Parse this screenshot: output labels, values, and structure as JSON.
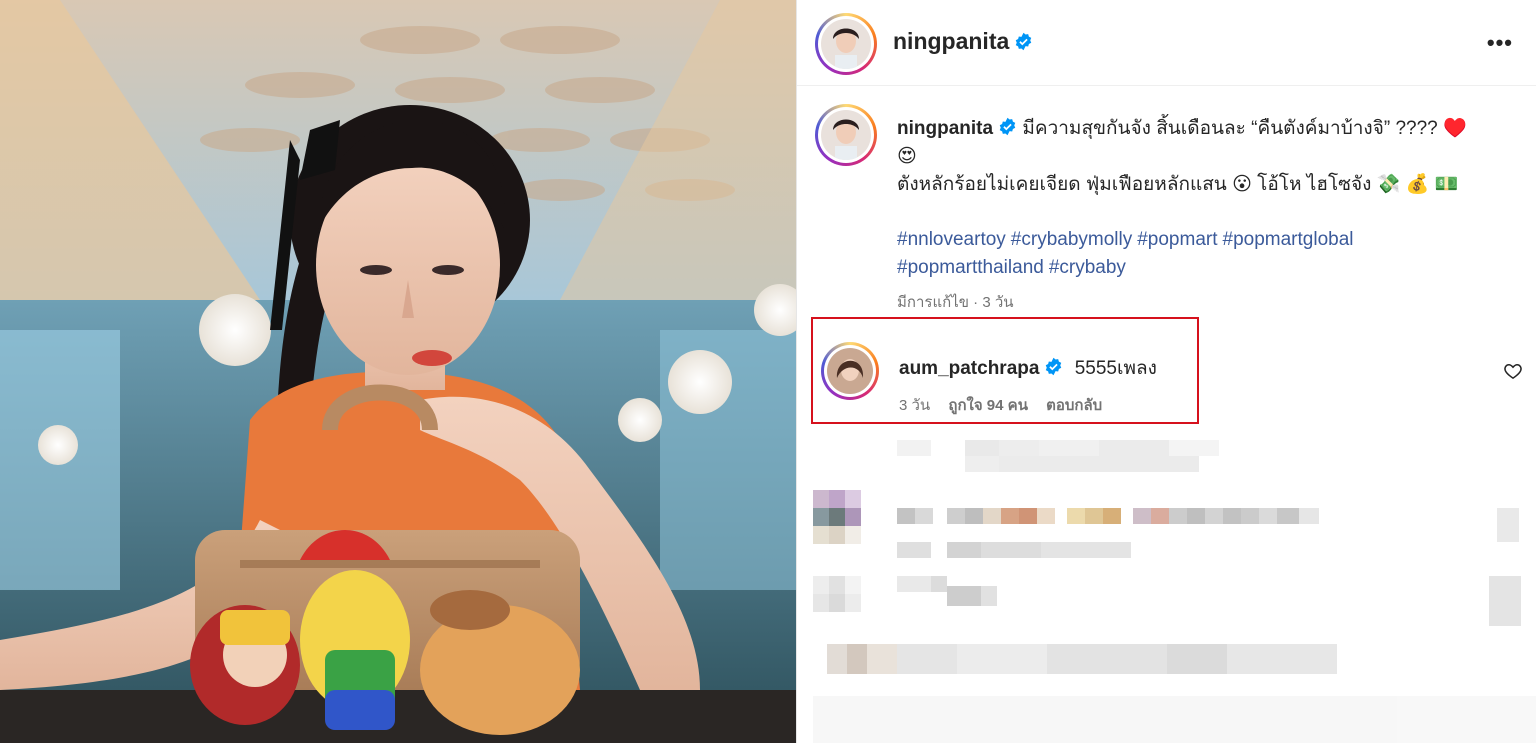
{
  "post": {
    "username": "ningpanita",
    "verified": true,
    "more_label": "•••",
    "caption": {
      "username": "ningpanita",
      "line1": "มีความสุขกันจัง สิ้นเดือนละ “คืนตังค์มาบ้างจิ” ???? ♥️",
      "line1_emoji": "😍",
      "line2": "ตังหลักร้อยไม่เคยเจียด ฟุ่มเฟือยหลักแสน 😮 โอ้โห ไฮโซจัง 💸 💰 💵",
      "hashtags": [
        "#nnloveartoy",
        "#crybabymolly",
        "#popmart",
        "#popmartglobal",
        "#popmartthailand",
        "#crybaby"
      ],
      "meta": "มีการแก้ไข · 3 วัน"
    }
  },
  "highlight_comment": {
    "username": "aum_patchrapa",
    "verified": true,
    "text": "5555เพลง",
    "time": "3 วัน",
    "likes": "ถูกใจ 94 คน",
    "reply_label": "ตอบกลับ"
  },
  "colors": {
    "highlight_border": "#d6111d",
    "hashtag": "#3b5a9a",
    "verified": "#0095f6",
    "muted": "#737373"
  },
  "icons": [
    "verified-badge-icon",
    "more-options-icon",
    "heart-icon"
  ]
}
